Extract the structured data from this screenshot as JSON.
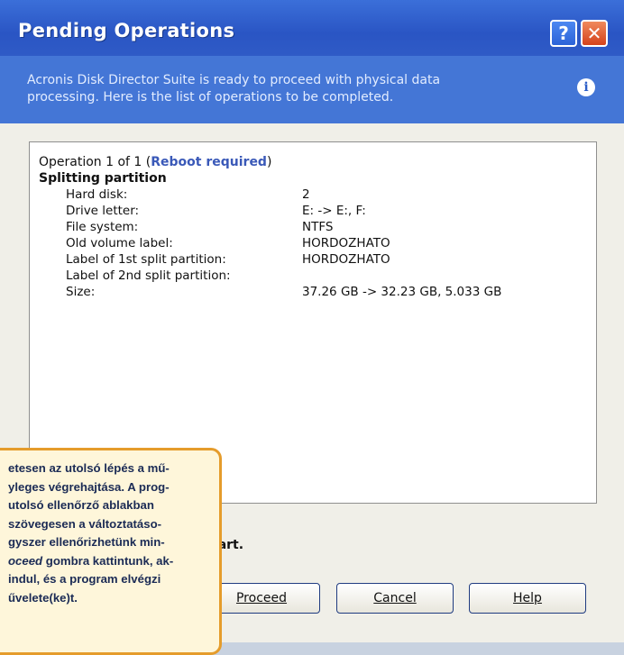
{
  "dialog": {
    "title": "Pending Operations",
    "help_glyph": "?",
    "close_glyph": "✕",
    "header_text": "Acronis Disk Director Suite is ready to proceed with physical data processing. Here is the list of operations to be completed.",
    "info_glyph": "i"
  },
  "operation": {
    "prefix": "Operation 1 of 1 (",
    "status": "Reboot required",
    "suffix": ")",
    "name": "Splitting partition",
    "details": [
      {
        "label": "Hard disk:",
        "value": "2"
      },
      {
        "label": "Drive letter:",
        "value": "E: -> E:, F:"
      },
      {
        "label": "File system:",
        "value": "NTFS"
      },
      {
        "label": "Old volume label:",
        "value": "HORDOZHATO"
      },
      {
        "label": "Label of 1st split partition:",
        "value": "HORDOZHATO"
      },
      {
        "label": "Label of 2nd split partition:",
        "value": ""
      },
      {
        "label": "Size:",
        "value": "37.26 GB -> 32.23 GB, 5.033 GB"
      }
    ]
  },
  "start_text": "tart.",
  "buttons": {
    "proceed": "Proceed",
    "cancel": "Cancel",
    "help": "Help"
  },
  "caption": {
    "line1": "etesen az utolsó lépés a mű-",
    "line2": "yleges végrehajtása. A prog-",
    "line3": " utolsó ellenőrző ablakban",
    "line4": " szövegesen a változtatáso-",
    "line5": "gyszer ellenőrizhetünk min-",
    "line6_em": "oceed",
    "line6_rest": " gombra kattintunk, ak-",
    "line7": "indul, és a program elvégzi",
    "line8": "űvelete(ke)t."
  },
  "colors": {
    "titlebar": "#2a55c4",
    "header": "#4476d6",
    "reboot_accent": "#3a59b8",
    "caption_border": "#e59c2b",
    "caption_bg": "#fef6da"
  }
}
